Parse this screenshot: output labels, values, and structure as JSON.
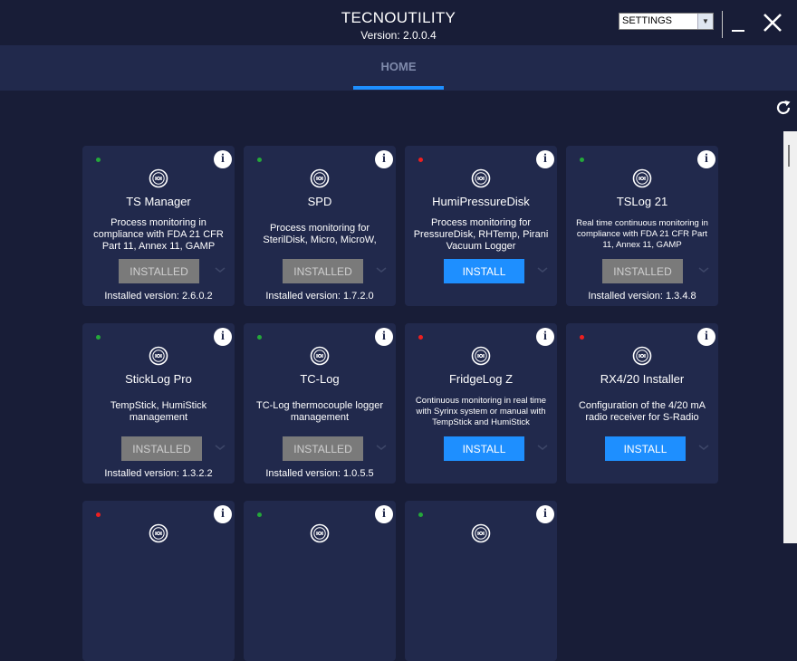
{
  "window": {
    "title": "TECNOUTILITY",
    "version": "Version: 2.0.0.4",
    "settings_select": "SETTINGS"
  },
  "nav": {
    "tabs": [
      {
        "label": "HOME",
        "active": true
      }
    ]
  },
  "colors": {
    "background": "#181d37",
    "card": "#21294c",
    "accent": "#1e8fff",
    "installed_button": "#7a7a7a",
    "status_ok": "#24a83a",
    "status_missing": "#ee1f1f"
  },
  "apps": [
    {
      "name": "TS Manager",
      "status": "green",
      "description": "Process monitoring in compliance with FDA 21 CFR Part 11, Annex 11, GAMP",
      "button": "INSTALLED",
      "installed": true,
      "installed_version": "Installed version: 2.6.0.2"
    },
    {
      "name": "SPD",
      "status": "green",
      "description": "Process monitoring for SterilDisk, Micro, MicroW,",
      "button": "INSTALLED",
      "installed": true,
      "installed_version": "Installed version: 1.7.2.0"
    },
    {
      "name": "HumiPressureDisk",
      "status": "red",
      "description": "Process monitoring for PressureDisk, RHTemp, Pirani Vacuum Logger",
      "button": "INSTALL",
      "installed": false,
      "installed_version": ""
    },
    {
      "name": "TSLog 21",
      "status": "green",
      "description": "Real time continuous monitoring in compliance with FDA 21 CFR Part 11, Annex 11, GAMP",
      "button": "INSTALLED",
      "installed": true,
      "installed_version": "Installed version: 1.3.4.8"
    },
    {
      "name": "StickLog Pro",
      "status": "green",
      "description": "TempStick, HumiStick management",
      "button": "INSTALLED",
      "installed": true,
      "installed_version": "Installed version: 1.3.2.2"
    },
    {
      "name": "TC-Log",
      "status": "green",
      "description": "TC-Log thermocouple logger management",
      "button": "INSTALLED",
      "installed": true,
      "installed_version": "Installed version: 1.0.5.5"
    },
    {
      "name": "FridgeLog Z",
      "status": "red",
      "description": "Continuous monitoring in real time with Syrinx system or manual with TempStick and HumiStick",
      "button": "INSTALL",
      "installed": false,
      "installed_version": ""
    },
    {
      "name": "RX4/20 Installer",
      "status": "red",
      "description": "Configuration of the 4/20 mA radio receiver for S-Radio",
      "button": "INSTALL",
      "installed": false,
      "installed_version": ""
    },
    {
      "name": "",
      "status": "red",
      "description": "",
      "button": "",
      "installed": false,
      "installed_version": ""
    },
    {
      "name": "",
      "status": "green",
      "description": "",
      "button": "",
      "installed": false,
      "installed_version": ""
    },
    {
      "name": "",
      "status": "green",
      "description": "",
      "button": "",
      "installed": false,
      "installed_version": ""
    }
  ]
}
